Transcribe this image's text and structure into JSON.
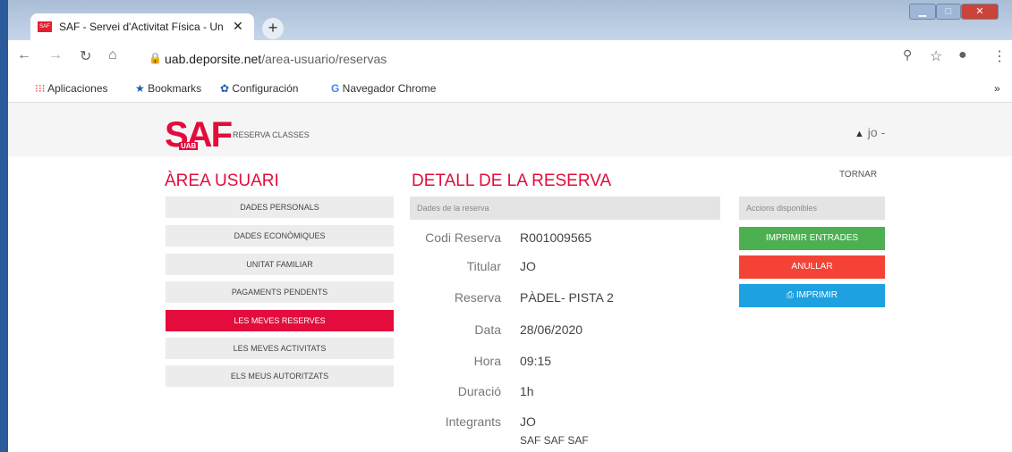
{
  "browser": {
    "tab_title": "SAF - Servei d'Activitat Física - Un",
    "tab_close": "✕",
    "new_tab": "+",
    "url_host": "uab.deporsite.net",
    "url_path": "/area-usuario/reservas",
    "bookmarks": [
      "Aplicaciones",
      "Bookmarks",
      "Configuración",
      "Navegador Chrome"
    ],
    "overflow": "»"
  },
  "site": {
    "logo": "SAF",
    "logo_sub": "UAB",
    "brand_subtitle": "RESERVA CLASSES",
    "user_name": "jo",
    "user_caret": "-"
  },
  "sidebar": {
    "title": "ÀREA USUARI",
    "items": [
      {
        "label": "DADES PERSONALS",
        "active": false
      },
      {
        "label": "DADES ECONÒMIQUES",
        "active": false
      },
      {
        "label": "UNITAT FAMILIAR",
        "active": false
      },
      {
        "label": "PAGAMENTS PENDENTS",
        "active": false
      },
      {
        "label": "LES MEVES RESERVES",
        "active": true
      },
      {
        "label": "LES MEVES ACTIVITATS",
        "active": false
      },
      {
        "label": "ELS MEUS AUTORITZATS",
        "active": false
      }
    ]
  },
  "detail": {
    "title": "DETALL DE LA RESERVA",
    "back_link": "TORNAR",
    "section_header": "Dades de la reserva",
    "fields": [
      {
        "label": "Codi Reserva",
        "value": "R001009565"
      },
      {
        "label": "Titular",
        "value": "JO"
      },
      {
        "label": "Reserva",
        "value": "PÀDEL- PISTA 2"
      },
      {
        "label": "Data",
        "value": "28/06/2020"
      },
      {
        "label": "Hora",
        "value": "09:15"
      },
      {
        "label": "Duració",
        "value": "1h"
      },
      {
        "label": "Integrants",
        "value": "JO"
      }
    ],
    "integrant_extra": "SAF SAF SAF"
  },
  "actions": {
    "header": "Accions disponibles",
    "print_tickets": "IMPRIMIR ENTRADES",
    "cancel": "ANULLAR",
    "print": "IMPRIMIR",
    "colors": {
      "green": "#4caf50",
      "red": "#f44336",
      "blue": "#1ea1e0"
    }
  }
}
